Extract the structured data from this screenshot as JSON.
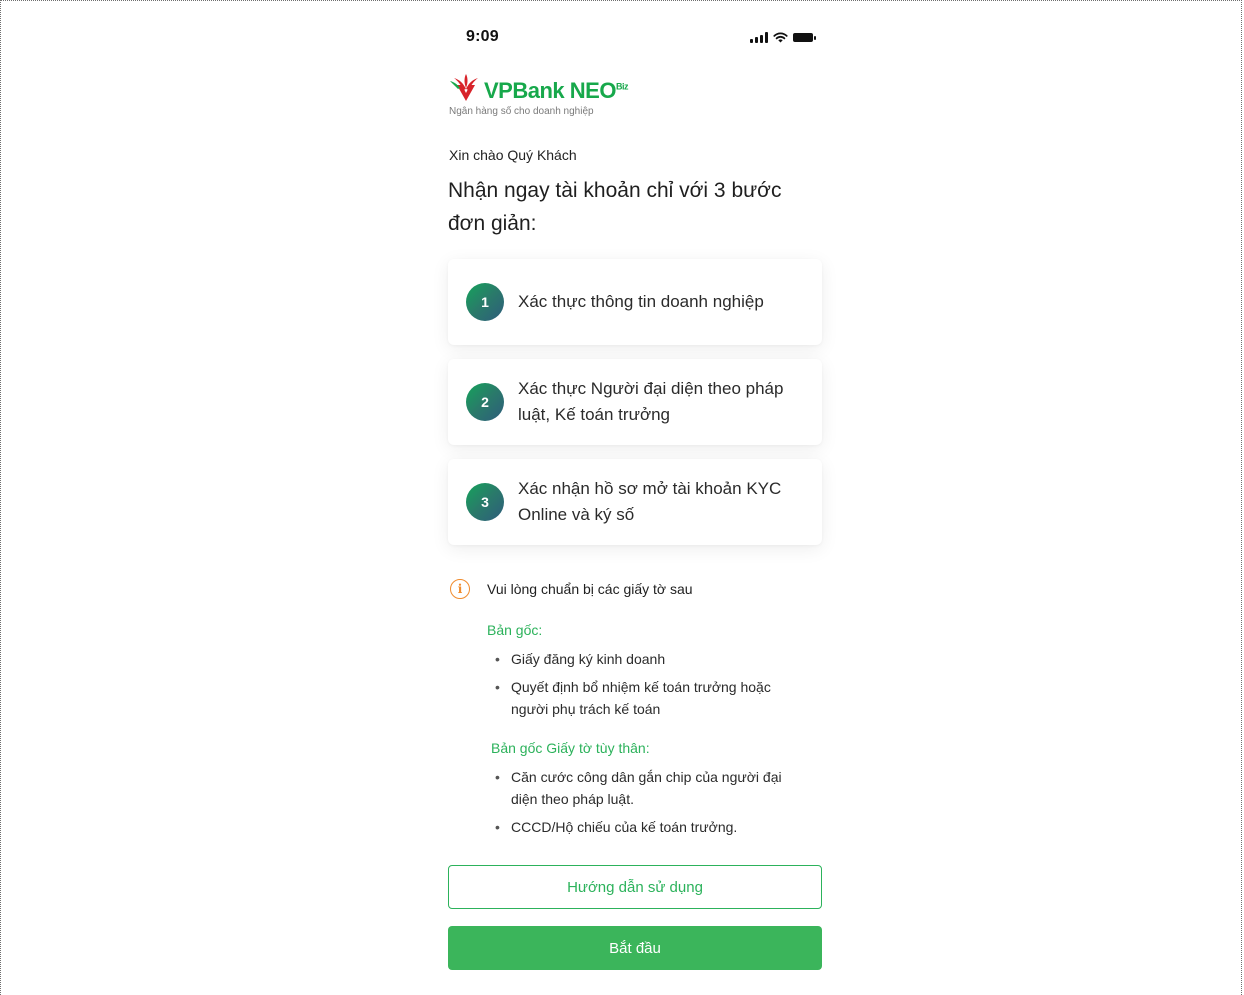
{
  "status_bar": {
    "time": "9:09"
  },
  "brand": {
    "name": "VPBank",
    "product": "NEO",
    "product_suffix": "Biz",
    "tagline": "Ngân hàng số cho doanh nghiệp",
    "brand_green": "#17a84b",
    "logo_red": "#d8232a"
  },
  "greeting": "Xin chào Quý Khách",
  "headline": "Nhận ngay tài khoản chỉ với 3 bước đơn giản:",
  "steps": [
    {
      "number": "1",
      "text": "Xác thực thông tin doanh nghiệp"
    },
    {
      "number": "2",
      "text": "Xác thực Người đại diện theo pháp luật, Kế toán trưởng"
    },
    {
      "number": "3",
      "text": "Xác nhận hồ sơ mở tài khoản KYC Online và ký số"
    }
  ],
  "documents": {
    "title": "Vui lòng chuẩn bị các giấy tờ sau",
    "icon": "info-icon",
    "groups": [
      {
        "heading": "Bản gốc:",
        "items": [
          "Giấy đăng ký kinh doanh",
          "Quyết định bổ nhiệm kế toán trưởng hoặc người phụ trách kế toán"
        ]
      },
      {
        "heading": "Bản gốc Giấy tờ tùy thân:",
        "items": [
          "Căn cước công dân gắn chip của người đại diện theo pháp luật.",
          "CCCD/Hộ chiếu của kế toán trưởng."
        ]
      }
    ]
  },
  "buttons": {
    "guide_label": "Hướng dẫn sử dụng",
    "start_label": "Bắt đầu"
  },
  "colors": {
    "accent_green": "#3bb55b",
    "info_orange": "#f08c2e"
  }
}
